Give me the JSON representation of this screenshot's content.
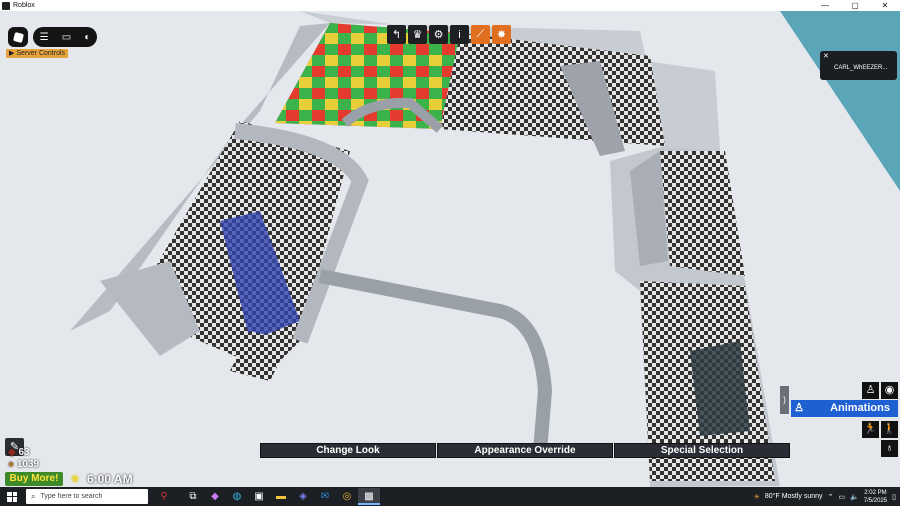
{
  "window": {
    "title": "Roblox",
    "controls": [
      "—",
      "▢",
      "✕"
    ]
  },
  "roblox_ui": {
    "menu_icons": [
      "menu-icon",
      "chat-icon",
      "headset-icon"
    ],
    "server_controls_label": "Server Controls",
    "toolbar": [
      {
        "icon": "back-arrow-icon",
        "glyph": "↰",
        "accent": false
      },
      {
        "icon": "trophy-icon",
        "glyph": "🏆",
        "accent": false
      },
      {
        "icon": "gear-icon",
        "glyph": "⚙",
        "accent": false
      },
      {
        "icon": "info-icon",
        "glyph": "i",
        "accent": false
      },
      {
        "icon": "wand-icon",
        "glyph": "⟋",
        "accent": true
      },
      {
        "icon": "bug-icon",
        "glyph": "✸",
        "accent": true
      }
    ],
    "toast": {
      "name": "CARL_WhEEZER..."
    }
  },
  "hud": {
    "stat_top": "63",
    "stat_bottom": "1039",
    "buy_label": "Buy More!",
    "time": "6:00 AM",
    "bottom_buttons": [
      "Change Look",
      "Appearance Override",
      "Special Selection"
    ],
    "animations_label": "Animations"
  },
  "taskbar": {
    "search_placeholder": "Type here to search",
    "weather": "80°F  Mostly sunny",
    "time": "2:02 PM",
    "date": "7/5/2025"
  },
  "colors": {
    "accent_blue": "#1e5fd1",
    "toolbar_orange": "#e0701f",
    "buy_green": "#3c8a2a",
    "sea": "#5aa6b8"
  }
}
